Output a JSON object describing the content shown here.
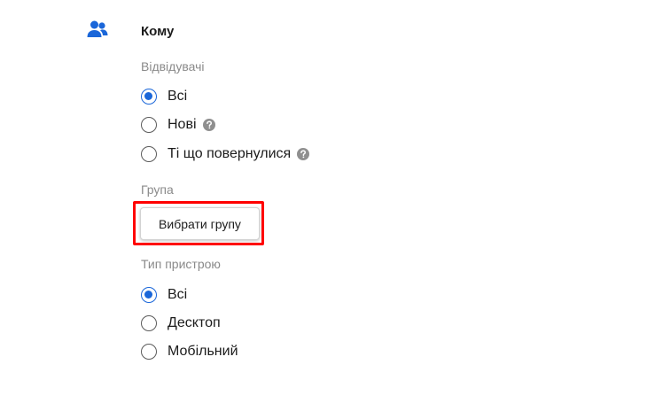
{
  "section": {
    "icon": "users-icon",
    "title": "Кому"
  },
  "visitors": {
    "label": "Відвідувачі",
    "options": [
      {
        "label": "Всі",
        "checked": true,
        "help": false
      },
      {
        "label": "Нові",
        "checked": false,
        "help": true
      },
      {
        "label": "Ті що повернулися",
        "checked": false,
        "help": true
      }
    ]
  },
  "group": {
    "label": "Група",
    "button_label": "Вибрати групу"
  },
  "device": {
    "label": "Тип пристрою",
    "options": [
      {
        "label": "Всі",
        "checked": true
      },
      {
        "label": "Десктоп",
        "checked": false
      },
      {
        "label": "Мобільний",
        "checked": false
      }
    ]
  },
  "colors": {
    "accent": "#1a66d9",
    "highlight": "#ff0000",
    "muted_text": "#8a8a8a"
  }
}
